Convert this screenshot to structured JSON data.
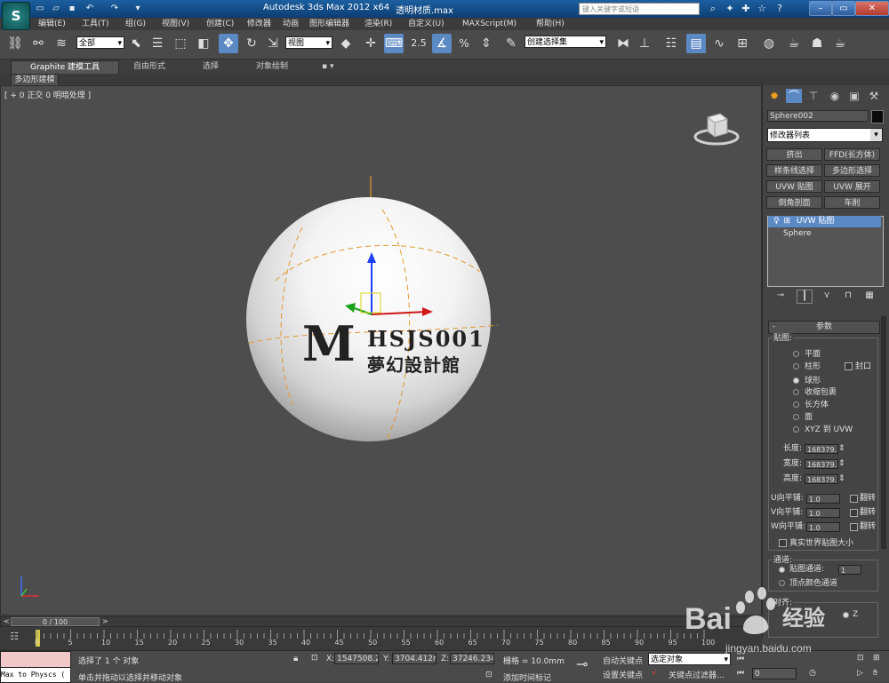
{
  "app": {
    "logo": "S",
    "title": "Autodesk 3ds Max  2012 x64",
    "file": "透明材质.max"
  },
  "search": {
    "placeholder": "键入关键字或短语"
  },
  "quick_access": [
    "new-icon",
    "open-icon",
    "save-icon",
    "undo-icon",
    "redo-icon",
    "more-icon"
  ],
  "menu": [
    "编辑(E)",
    "工具(T)",
    "组(G)",
    "视图(V)",
    "创建(C)",
    "修改器",
    "动画",
    "图形编辑器",
    "渲染(R)",
    "自定义(U)",
    "MAXScript(M)",
    "帮助(H)"
  ],
  "toolbar": {
    "selection_filter": "全部",
    "ref_coord": "视图",
    "snap_angle_label": "2.5",
    "named_selection": "创建选择集",
    "percent_label": "%"
  },
  "ribbon": {
    "tabs": [
      "Graphite 建模工具",
      "自由形式",
      "选择",
      "对象绘制"
    ],
    "sub": "多边形建模"
  },
  "viewport": {
    "label": "[ + 0 正交 0 明暗处理 ]",
    "logo": {
      "m": "M",
      "line1": "HSJS001",
      "line2": "夢幻設計館"
    }
  },
  "command_panel": {
    "object_name": "Sphere002",
    "modifier_list": "修改器列表",
    "modifier_buttons": [
      "挤出",
      "FFD(长方体)",
      "样条线选择",
      "多边形选择",
      "UVW 贴图",
      "UVW 展开",
      "倒角剖面",
      "车削"
    ],
    "stack": {
      "selected": "UVW 贴图",
      "base": "Sphere"
    },
    "rollout": "参数",
    "mapping_label": "贴图:",
    "mapping_options": [
      "平面",
      "柱形",
      "球形",
      "收缩包裹",
      "长方体",
      "面",
      "XYZ 到 UVW"
    ],
    "mapping_selected": "球形",
    "cap_label": "封口",
    "length_label": "长度:",
    "width_label": "宽度:",
    "height_label": "高度:",
    "length_val": "168379.",
    "width_val": "168379.",
    "height_val": "168379.",
    "u_tile_label": "U向平铺:",
    "v_tile_label": "V向平铺:",
    "w_tile_label": "W向平铺:",
    "u_tile": "1.0",
    "v_tile": "1.0",
    "w_tile": "1.0",
    "flip_label": "翻转",
    "real_world": "真实世界贴图大小",
    "channel_label": "通道:",
    "map_channel": "贴图通道:",
    "map_channel_val": "1",
    "vertex_channel": "顶点颜色通道",
    "align_label": "对齐:",
    "align_z": "Z"
  },
  "timeline": {
    "frame": "0 / 100",
    "ticks": [
      "0",
      "5",
      "10",
      "15",
      "20",
      "25",
      "30",
      "35",
      "40",
      "45",
      "50",
      "55",
      "60",
      "65",
      "70",
      "75",
      "80",
      "85",
      "90",
      "95",
      "100"
    ]
  },
  "status": {
    "maxscript": "Max to Physcs (",
    "selected": "选择了 1 个 对象",
    "prompt": "单击并拖动以选择并移动对象",
    "x_label": "X:",
    "x": "1547508.2",
    "y_label": "Y:",
    "y": "3704.412m",
    "z_label": "Z:",
    "z": "37246.234",
    "grid": "栅格 = 10.0mm",
    "add_time_tag": "添加时间标记",
    "auto_key": "自动关键点",
    "set_key": "设置关键点",
    "selected_obj": "选定对象",
    "key_filter": "关键点过滤器...",
    "frame_val": "0"
  },
  "watermark": {
    "brand": "Bai",
    "brand2": "经验",
    "url": "jingyan.baidu.com"
  },
  "colors": {
    "title_bar": "#0d3e73",
    "selection_blue": "#5b89c4",
    "background": "#444444"
  }
}
